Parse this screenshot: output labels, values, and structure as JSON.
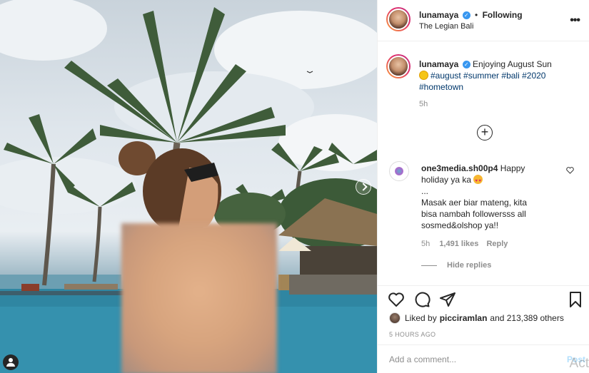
{
  "post": {
    "username": "lunamaya",
    "verified_mark": "✓",
    "separator": "•",
    "follow_status": "Following",
    "location": "The Legian Bali",
    "more_icon": "more-horizontal-icon"
  },
  "caption": {
    "username": "lunamaya",
    "text_before": "Enjoying August Sun",
    "emoji": "sun-emoji",
    "hashtags": [
      "#august",
      "#summer",
      "#bali",
      "#2020",
      "#hometown"
    ],
    "time": "5h"
  },
  "load_more_symbol": "+",
  "comment": {
    "username": "one3media.sh00p4",
    "line1": "Happy",
    "line2": "holiday ya ka",
    "emoji": "heart-eyes-emoji",
    "line3": "...",
    "line4": "Masak aer biar mateng, kita",
    "line5": "bisa nambah followersss all",
    "line6": "sosmed&olshop ya!!",
    "time": "5h",
    "likes": "1,491 likes",
    "reply_label": "Reply",
    "hide_replies_label": "Hide replies"
  },
  "actions": {
    "liked_by_prefix": "Liked by",
    "liked_by_user": "picciramlan",
    "liked_by_suffix": "and 213,389 others",
    "time_ago": "5 HOURS AGO"
  },
  "add_comment": {
    "placeholder": "Add a comment...",
    "post_label": "Post"
  },
  "watermark_text": "Act",
  "colors": {
    "link": "#00376b",
    "verified": "#3897f0",
    "muted": "#8e8e8e",
    "post_disabled": "#b2dffc"
  }
}
